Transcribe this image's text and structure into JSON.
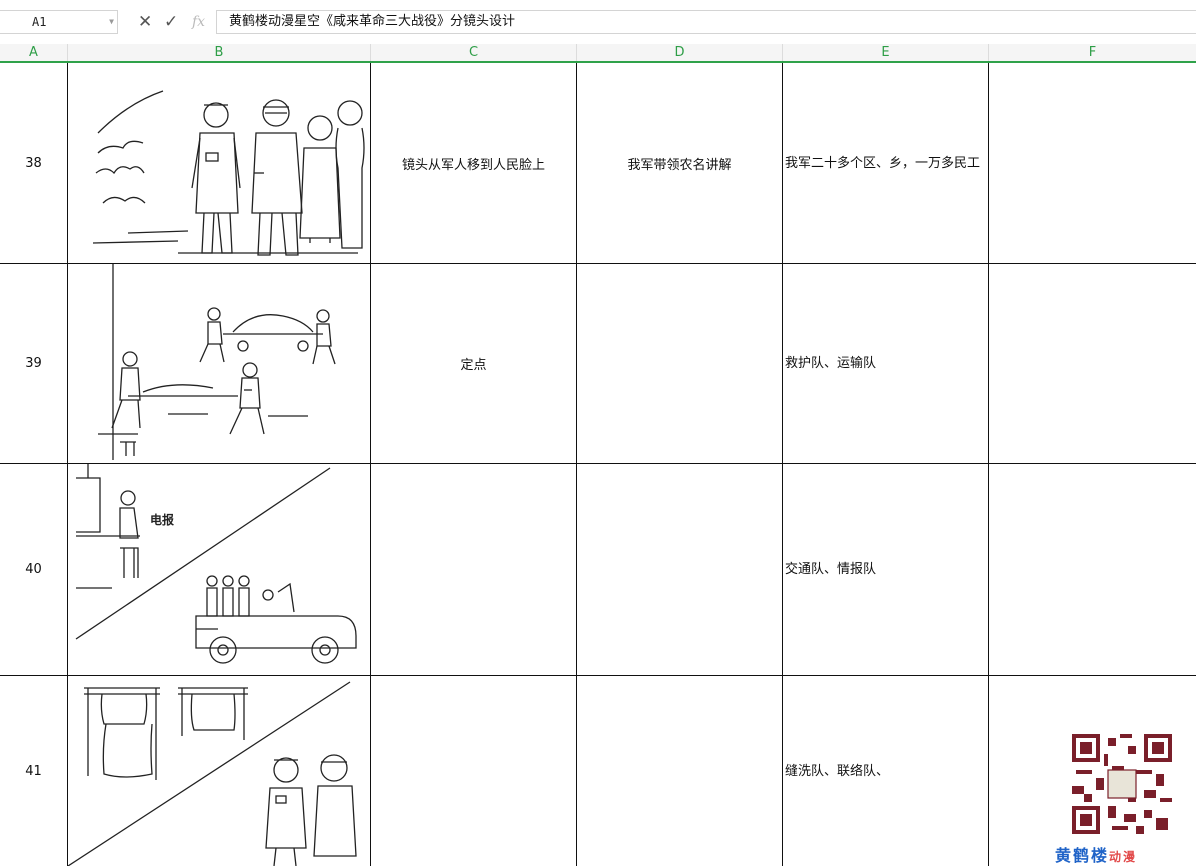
{
  "formula_bar": {
    "name_box": "A1",
    "cancel_icon": "close-icon",
    "confirm_icon": "check-icon",
    "fx_label": "fx",
    "content": "黄鹤楼动漫星空《咸来革命三大战役》分镜头设计"
  },
  "columns": [
    "A",
    "B",
    "C",
    "D",
    "E",
    "F"
  ],
  "rows": [
    {
      "num": "38",
      "c": "镜头从军人移到人民脸上",
      "d": "我军带领农名讲解",
      "e": "我军二十多个区、乡，一万多民工",
      "f": ""
    },
    {
      "num": "39",
      "c": "定点",
      "d": "",
      "e": "救护队、运输队",
      "f": ""
    },
    {
      "num": "40",
      "c": "",
      "d": "",
      "e": "交通队、情报队",
      "f": ""
    },
    {
      "num": "41",
      "c": "",
      "d": "",
      "e": "缝洗队、联络队、",
      "f": ""
    }
  ],
  "sketch_labels": {
    "telegraph": "电报"
  },
  "watermark": {
    "logo_text": "黄鹤楼",
    "logo_suffix": "动漫"
  },
  "colors": {
    "header_accent": "#2fa24a",
    "logo_blue": "#1f63c8",
    "logo_red": "#e24b4b"
  }
}
